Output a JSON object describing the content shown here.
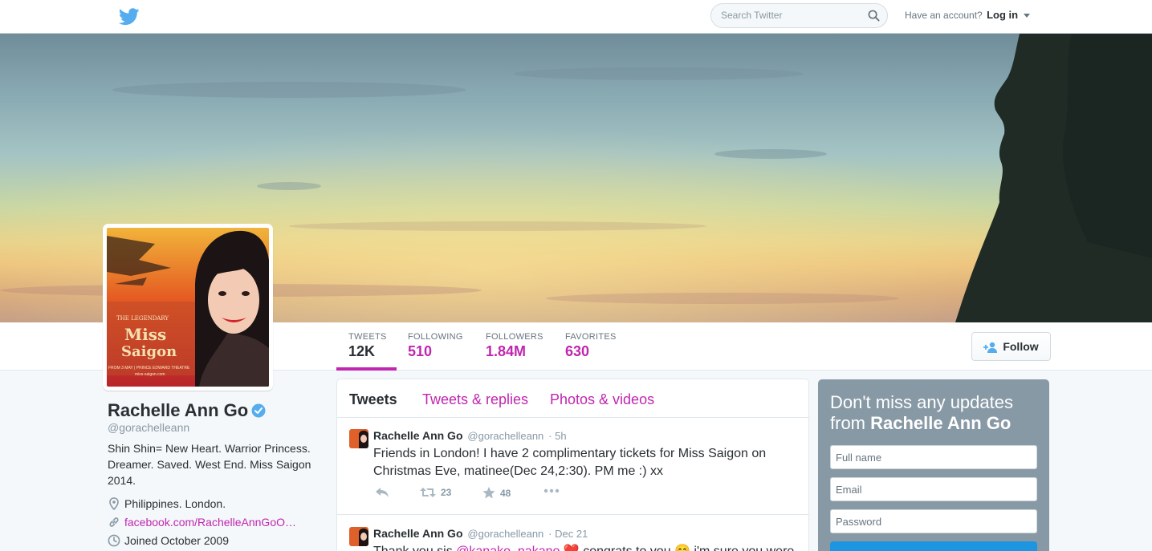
{
  "header": {
    "search_placeholder": "Search Twitter",
    "account_text": "Have an account?",
    "login_label": "Log in"
  },
  "nav_stats": [
    {
      "label": "TWEETS",
      "value": "12K"
    },
    {
      "label": "FOLLOWING",
      "value": "510"
    },
    {
      "label": "FOLLOWERS",
      "value": "1.84M"
    },
    {
      "label": "FAVORITES",
      "value": "630"
    }
  ],
  "follow_label": "Follow",
  "profile": {
    "name": "Rachelle Ann Go",
    "handle": "@gorachelleann",
    "bio": "Shin Shin= New Heart. Warrior Princess. Dreamer. Saved. West End. Miss Saigon 2014.",
    "location": "Philippines. London.",
    "website": "facebook.com/RachelleAnnGoO…",
    "joined": "Joined October 2009"
  },
  "avatar_text": {
    "poster_line1": "THE LEGENDARY",
    "poster_line2": "Miss",
    "poster_line3": "Saigon",
    "poster_line4": "FROM 3 MAY | PRINCE EDWARD THEATRE",
    "poster_line5": "miss-saigon.com"
  },
  "timeline": {
    "tabs": [
      "Tweets",
      "Tweets & replies",
      "Photos & videos"
    ],
    "tweets": [
      {
        "name": "Rachelle Ann Go",
        "handle": "@gorachelleann",
        "time": "· 5h",
        "text": "Friends in London! I have 2 complimentary tickets for Miss Saigon on Christmas Eve, matinee(Dec 24,2:30). PM me :) xx",
        "retweets": "23",
        "favorites": "48"
      },
      {
        "name": "Rachelle Ann Go",
        "handle": "@gorachelleann",
        "time": "· Dec 21",
        "text_before": "Thank you sis ",
        "mention": "@kanako_nakano",
        "text_after": " ❤️ congrats to you 😊 i'm sure you were"
      }
    ]
  },
  "signup": {
    "title_prefix": "Don't miss any updates from ",
    "title_name": "Rachelle Ann Go",
    "fullname_placeholder": "Full name",
    "email_placeholder": "Email",
    "password_placeholder": "Password"
  },
  "colors": {
    "link": "#c026b0",
    "twitter_blue": "#55acee",
    "signup_bg": "#8899a6"
  }
}
